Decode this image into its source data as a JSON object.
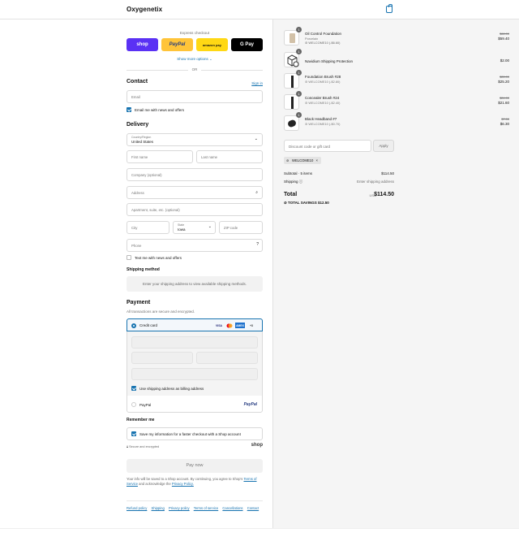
{
  "header": {
    "brand": "Oxygenetix"
  },
  "express": {
    "title": "Express checkout",
    "buttons": [
      "shop",
      "PayPal",
      "amazon pay",
      "G Pay"
    ],
    "show_more": "Show more options ⌄",
    "or": "OR"
  },
  "contact": {
    "title": "Contact",
    "sign_in": "Sign in",
    "email_placeholder": "Email",
    "news_label": "Email me with news and offers"
  },
  "delivery": {
    "title": "Delivery",
    "country_label": "Country/Region",
    "country_value": "United States",
    "first_name": "First name",
    "last_name": "Last name",
    "company": "Company (optional)",
    "address": "Address",
    "apartment": "Apartment, suite, etc. (optional)",
    "city": "City",
    "state_label": "State",
    "state_value": "Iowa",
    "zip": "ZIP code",
    "phone": "Phone",
    "text_label": "Text me with news and offers"
  },
  "shipping": {
    "title": "Shipping method",
    "message": "Enter your shipping address to view available shipping methods."
  },
  "payment": {
    "title": "Payment",
    "subtitle": "All transactions are secure and encrypted.",
    "credit_card": "Credit card",
    "card_logos": [
      "VISA",
      "MC",
      "AMEX",
      "+3"
    ],
    "billing_label": "Use shipping address as billing address",
    "paypal": "PayPal",
    "paypal_logo": "PayPal"
  },
  "remember": {
    "title": "Remember me",
    "save_label": "Save my information for a faster checkout with a Shop account",
    "secure": "Secure and encrypted",
    "shop": "shop"
  },
  "paynow": "Pay now",
  "legal": {
    "text": "Your info will be saved to a Shop account. By continuing, you agree to Shop's",
    "terms": "Terms of Service",
    "and": "and acknowledge the",
    "privacy": "Privacy Policy."
  },
  "footer_links": [
    "Refund policy",
    "Shipping",
    "Privacy policy",
    "Terms of service",
    "Cancellations",
    "Contact"
  ],
  "order": {
    "products": [
      {
        "qty": "1",
        "name": "Oil Control Foundation",
        "variant": "Porcelain",
        "discount": "WELCOME10 (-$6.60)",
        "old": "$66.00",
        "price": "$59.40"
      },
      {
        "qty": "1",
        "name": "Navidium Shipping Protection",
        "variant": "",
        "discount": "",
        "old": "",
        "price": "$2.00"
      },
      {
        "qty": "1",
        "name": "Foundation Brush #28",
        "variant": "",
        "discount": "WELCOME10 (-$2.80)",
        "old": "$28.00",
        "price": "$25.20"
      },
      {
        "qty": "1",
        "name": "Concealer Brush #24",
        "variant": "",
        "discount": "WELCOME10 (-$2.40)",
        "old": "$24.00",
        "price": "$21.60"
      },
      {
        "qty": "1",
        "name": "Black Headband #7",
        "variant": "",
        "discount": "WELCOME10 (-$0.70)",
        "old": "$7.00",
        "price": "$6.30"
      }
    ],
    "discount_placeholder": "Discount code or gift card",
    "apply": "Apply",
    "coupon": "WELCOME10",
    "subtotal_label": "Subtotal · 5 items",
    "subtotal": "$114.50",
    "shipping_label": "Shipping",
    "shipping_value": "Enter shipping address",
    "total_label": "Total",
    "currency": "USD",
    "total": "$114.50",
    "savings_label": "TOTAL SAVINGS",
    "savings": "$12.50"
  }
}
